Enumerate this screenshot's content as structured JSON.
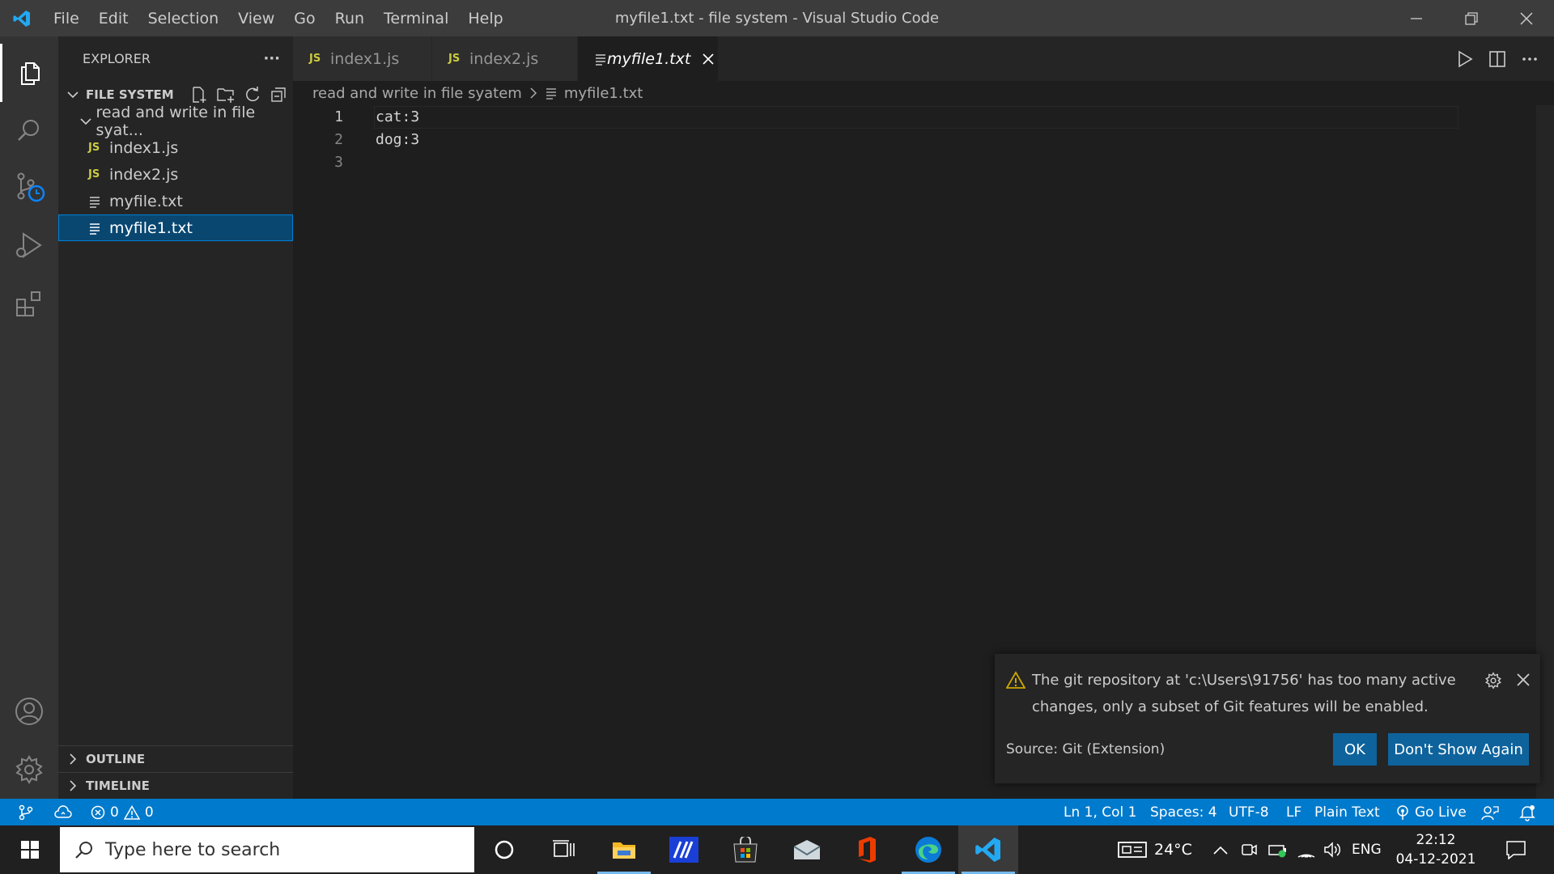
{
  "titlebar": {
    "menu": [
      "File",
      "Edit",
      "Selection",
      "View",
      "Go",
      "Run",
      "Terminal",
      "Help"
    ],
    "window_title": "myfile1.txt - file system - Visual Studio Code"
  },
  "activitybar": {
    "items": [
      "explorer",
      "search",
      "source-control",
      "run-and-debug",
      "extensions"
    ],
    "bottom": [
      "accounts",
      "manage"
    ]
  },
  "sidebar": {
    "title": "EXPLORER",
    "more": "···",
    "section_title": "FILE SYSTEM",
    "folder": "read and write in file syat...",
    "files": [
      {
        "name": "index1.js",
        "type": "js"
      },
      {
        "name": "index2.js",
        "type": "js"
      },
      {
        "name": "myfile.txt",
        "type": "txt"
      },
      {
        "name": "myfile1.txt",
        "type": "txt",
        "selected": true
      }
    ],
    "outline": "OUTLINE",
    "timeline": "TIMELINE"
  },
  "tabs": [
    {
      "label": "index1.js",
      "type": "js"
    },
    {
      "label": "index2.js",
      "type": "js"
    },
    {
      "label": "myfile1.txt",
      "type": "txt",
      "active": true
    }
  ],
  "js_badge": "JS",
  "breadcrumb": {
    "folder": "read and write in file syatem",
    "file": "myfile1.txt"
  },
  "editor": {
    "lines": [
      {
        "num": "1",
        "text": "cat:3"
      },
      {
        "num": "2",
        "text": "dog:3"
      },
      {
        "num": "3",
        "text": ""
      }
    ]
  },
  "notification": {
    "message": "The git repository at 'c:\\Users\\91756' has too many active changes, only a subset of Git features will be enabled.",
    "source": "Source: Git (Extension)",
    "ok": "OK",
    "dont_show": "Don't Show Again"
  },
  "statusbar": {
    "errors": "0",
    "warnings": "0",
    "position": "Ln 1, Col 1",
    "spaces": "Spaces: 4",
    "encoding": "UTF-8",
    "eol": "LF",
    "language": "Plain Text",
    "golive": "Go Live"
  },
  "taskbar": {
    "search_placeholder": "Type here to search",
    "weather": "24°C",
    "language": "ENG",
    "time": "22:12",
    "date": "04-12-2021"
  },
  "colors": {
    "accent": "#007acc",
    "selection": "#094771",
    "button": "#0e639c",
    "js_icon": "#cbcb41"
  }
}
